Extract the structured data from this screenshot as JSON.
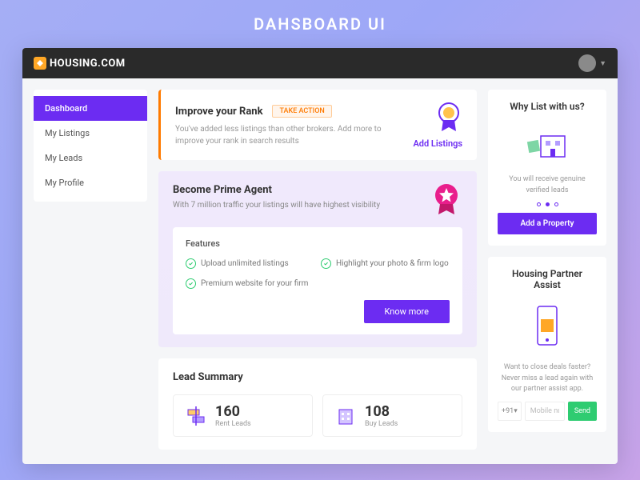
{
  "outer_title": "DAHSBOARD UI",
  "brand": "HOUSING.COM",
  "sidebar": {
    "items": [
      {
        "label": "Dashboard",
        "active": true
      },
      {
        "label": "My Listings",
        "active": false
      },
      {
        "label": "My Leads",
        "active": false
      },
      {
        "label": "My Profile",
        "active": false
      }
    ]
  },
  "rank": {
    "title": "Improve your Rank",
    "badge": "TAKE ACTION",
    "text": "You've added less listings than other brokers. Add more to improve your rank in search results",
    "link": "Add Listings"
  },
  "prime": {
    "title": "Become Prime Agent",
    "subtitle": "With 7 million traffic your listings will have highest visibility",
    "features_title": "Features",
    "features": [
      "Upload unlimited listings",
      "Highlight your photo & firm logo",
      "Premium website for your firm"
    ],
    "button": "Know more"
  },
  "lead_summary": {
    "title": "Lead Summary",
    "items": [
      {
        "value": "160",
        "label": "Rent Leads"
      },
      {
        "value": "108",
        "label": "Buy Leads"
      }
    ]
  },
  "why_list": {
    "title": "Why List with us?",
    "text": "You will receive genuine verified leads",
    "button": "Add a Property"
  },
  "partner": {
    "title": "Housing Partner Assist",
    "text": "Want to close deals faster? Never miss a lead again with our partner assist app.",
    "cc": "+91",
    "placeholder": "Mobile number",
    "send": "Send"
  }
}
